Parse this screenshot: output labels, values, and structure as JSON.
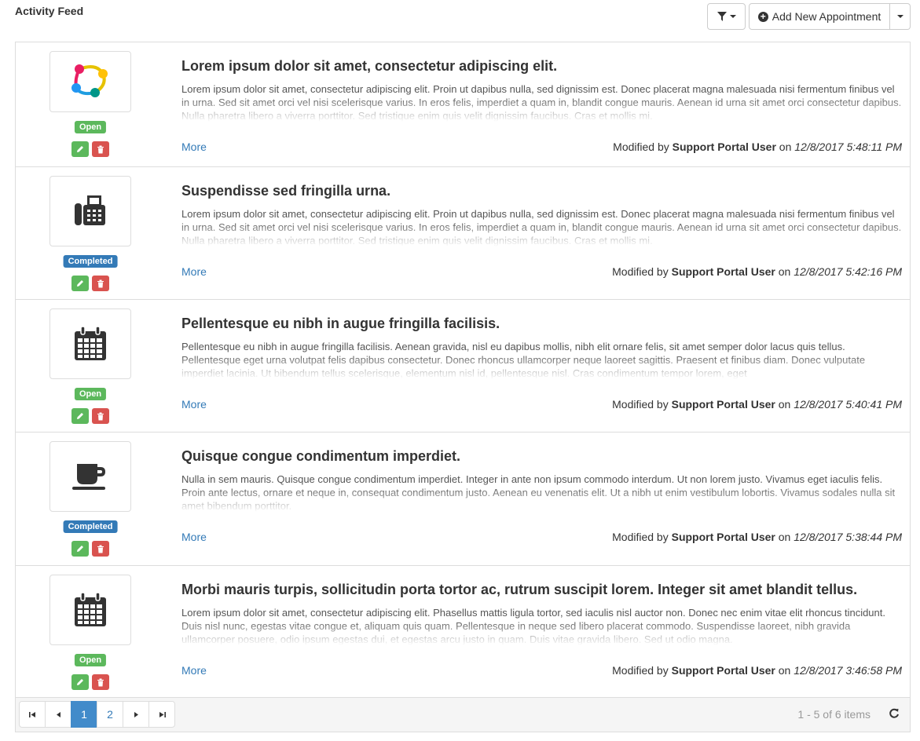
{
  "header": {
    "title": "Activity Feed",
    "add_button_label": "Add New Appointment"
  },
  "items": [
    {
      "icon": "network-logo-icon",
      "title": "Lorem ipsum dolor sit amet, consectetur adipiscing elit.",
      "description": "Lorem ipsum dolor sit amet, consectetur adipiscing elit. Proin ut dapibus nulla, sed dignissim est. Donec placerat magna malesuada nisi fermentum finibus vel in urna. Sed sit amet orci vel nisi scelerisque varius. In eros felis, imperdiet a quam in, blandit congue mauris. Aenean id urna sit amet orci consectetur dapibus. Nulla pharetra libero a viverra porttitor. Sed tristique enim quis velit dignissim faucibus. Cras et mollis mi.",
      "status": "Open",
      "more_label": "More",
      "modified_prefix": "Modified by",
      "modified_user": "Support Portal User",
      "modified_on": "on",
      "modified_date": "12/8/2017 5:48:11 PM"
    },
    {
      "icon": "fax-icon",
      "title": "Suspendisse sed fringilla urna.",
      "description": "Lorem ipsum dolor sit amet, consectetur adipiscing elit. Proin ut dapibus nulla, sed dignissim est. Donec placerat magna malesuada nisi fermentum finibus vel in urna. Sed sit amet orci vel nisi scelerisque varius. In eros felis, imperdiet a quam in, blandit congue mauris. Aenean id urna sit amet orci consectetur dapibus. Nulla pharetra libero a viverra porttitor. Sed tristique enim quis velit dignissim faucibus. Cras et mollis mi.",
      "status": "Completed",
      "more_label": "More",
      "modified_prefix": "Modified by",
      "modified_user": "Support Portal User",
      "modified_on": "on",
      "modified_date": "12/8/2017 5:42:16 PM"
    },
    {
      "icon": "calendar-icon",
      "title": "Pellentesque eu nibh in augue fringilla facilisis.",
      "description": "Pellentesque eu nibh in augue fringilla facilisis. Aenean gravida, nisl eu dapibus mollis, nibh elit ornare felis, sit amet semper dolor lacus quis tellus. Pellentesque eget urna volutpat felis dapibus consectetur. Donec rhoncus ullamcorper neque laoreet sagittis. Praesent et finibus diam. Donec vulputate imperdiet lacinia. Ut bibendum tellus scelerisque, elementum nisl id, pellentesque nisl. Cras condimentum tempor lorem, eget",
      "status": "Open",
      "more_label": "More",
      "modified_prefix": "Modified by",
      "modified_user": "Support Portal User",
      "modified_on": "on",
      "modified_date": "12/8/2017 5:40:41 PM"
    },
    {
      "icon": "coffee-cup-icon",
      "title": "Quisque congue condimentum imperdiet.",
      "description": "Nulla in sem mauris. Quisque congue condimentum imperdiet. Integer in ante non ipsum commodo interdum. Ut non lorem justo. Vivamus eget iaculis felis. Proin ante lectus, ornare et neque in, consequat condimentum justo. Aenean eu venenatis elit. Ut a nibh ut enim vestibulum lobortis. Vivamus sodales nulla sit amet bibendum porttitor.",
      "status": "Completed",
      "more_label": "More",
      "modified_prefix": "Modified by",
      "modified_user": "Support Portal User",
      "modified_on": "on",
      "modified_date": "12/8/2017 5:38:44 PM"
    },
    {
      "icon": "calendar-icon",
      "title": "Morbi mauris turpis, sollicitudin porta tortor ac, rutrum suscipit lorem. Integer sit amet blandit tellus.",
      "description": "Lorem ipsum dolor sit amet, consectetur adipiscing elit. Phasellus mattis ligula tortor, sed iaculis nisl auctor non. Donec nec enim vitae elit rhoncus tincidunt. Duis nisl nunc, egestas vitae congue et, aliquam quis quam. Pellentesque in neque sed libero placerat commodo. Suspendisse laoreet, nibh gravida ullamcorper posuere, odio ipsum egestas dui, et egestas arcu justo in quam. Duis vitae gravida libero. Sed ut odio magna.",
      "status": "Open",
      "more_label": "More",
      "modified_prefix": "Modified by",
      "modified_user": "Support Portal User",
      "modified_on": "on",
      "modified_date": "12/8/2017 3:46:58 PM"
    }
  ],
  "pager": {
    "pages": [
      "1",
      "2"
    ],
    "current_page": "1",
    "info": "1 - 5 of 6 items"
  },
  "colors": {
    "open": "#5cb85c",
    "completed": "#337ab7",
    "edit": "#5cb85c",
    "delete": "#d9534f",
    "link": "#337ab7",
    "active_page": "#428bca"
  }
}
